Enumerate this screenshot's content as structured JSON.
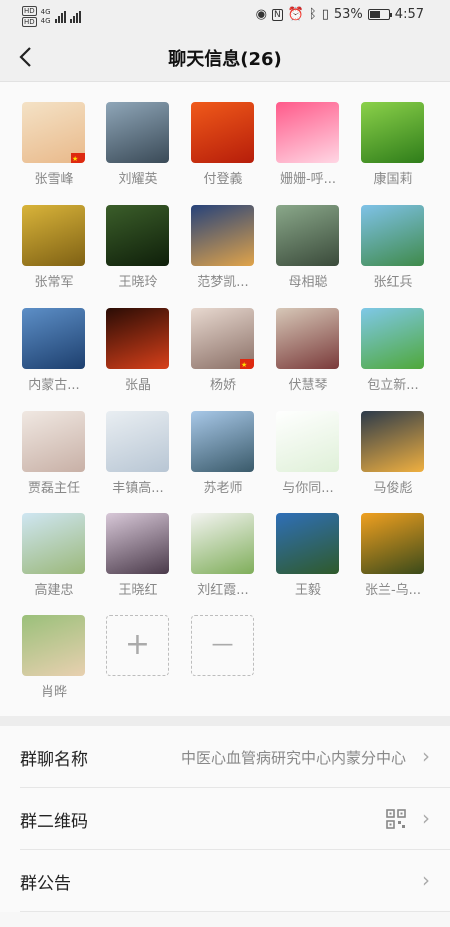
{
  "status_bar": {
    "network_left": [
      "HD",
      "4G",
      "HD",
      "4G"
    ],
    "battery": "53%",
    "time": "4:57"
  },
  "header": {
    "back_icon": "chevron-left-icon",
    "title": "聊天信息(26)"
  },
  "members": [
    {
      "name": "张雪峰",
      "avatar_colors": [
        "#f4e2c6",
        "#e9b98a"
      ],
      "flag": true
    },
    {
      "name": "刘耀英",
      "avatar_colors": [
        "#8fa6b8",
        "#3a4a57"
      ]
    },
    {
      "name": "付登義",
      "avatar_colors": [
        "#f05a1a",
        "#b61d0a"
      ]
    },
    {
      "name": "姗姗-呼...",
      "avatar_colors": [
        "#ff5a8a",
        "#ffd7e4"
      ]
    },
    {
      "name": "康国莉",
      "avatar_colors": [
        "#8bd14a",
        "#2f7d1a"
      ]
    },
    {
      "name": "张常军",
      "avatar_colors": [
        "#d9b43a",
        "#7f6114"
      ]
    },
    {
      "name": "王晓玲",
      "avatar_colors": [
        "#3b5e2a",
        "#0f1f0a"
      ]
    },
    {
      "name": "范梦凯...",
      "avatar_colors": [
        "#26427a",
        "#e1a44a"
      ]
    },
    {
      "name": "母相聪",
      "avatar_colors": [
        "#8aa88a",
        "#3a4a3a"
      ]
    },
    {
      "name": "张红兵",
      "avatar_colors": [
        "#7fc2e8",
        "#3f8a4a"
      ]
    },
    {
      "name": "内蒙古...",
      "avatar_colors": [
        "#5d8fc7",
        "#1d3f6e"
      ]
    },
    {
      "name": "张晶",
      "avatar_colors": [
        "#2a0c05",
        "#d8401a"
      ]
    },
    {
      "name": "杨娇",
      "avatar_colors": [
        "#e8d9d0",
        "#8a6f66"
      ],
      "flag": true
    },
    {
      "name": "伏慧琴",
      "avatar_colors": [
        "#d7c8b8",
        "#7a3a3a"
      ]
    },
    {
      "name": "包立新...",
      "avatar_colors": [
        "#7fc8e8",
        "#4fa83a"
      ]
    },
    {
      "name": "贾磊主任",
      "avatar_colors": [
        "#f0e8e2",
        "#c8b0a6"
      ]
    },
    {
      "name": "丰镇高...",
      "avatar_colors": [
        "#e9eef2",
        "#b8c6d4"
      ]
    },
    {
      "name": "苏老师",
      "avatar_colors": [
        "#a8c8e8",
        "#3a5a6a"
      ]
    },
    {
      "name": "与你同...",
      "avatar_colors": [
        "#ffffff",
        "#dff0d8"
      ]
    },
    {
      "name": "马俊彪",
      "avatar_colors": [
        "#2c3a4a",
        "#f0b040"
      ]
    },
    {
      "name": "高建忠",
      "avatar_colors": [
        "#cfe6f2",
        "#9bb87a"
      ]
    },
    {
      "name": "王晓红",
      "avatar_colors": [
        "#d8c8d8",
        "#4a3a4a"
      ]
    },
    {
      "name": "刘红霞...",
      "avatar_colors": [
        "#f4f4f2",
        "#7fae5a"
      ]
    },
    {
      "name": "王毅",
      "avatar_colors": [
        "#2f6fb8",
        "#2f5a2a"
      ]
    },
    {
      "name": "张兰-乌...",
      "avatar_colors": [
        "#f0a020",
        "#3a4a1a"
      ]
    },
    {
      "name": "肖晔",
      "avatar_colors": [
        "#9ac07a",
        "#e8d0b0"
      ]
    }
  ],
  "controls": {
    "add_symbol": "+",
    "remove_symbol": "—"
  },
  "settings": {
    "group_name_label": "群聊名称",
    "group_name_value": "中医心血管病研究中心内蒙分中心",
    "qr_label": "群二维码",
    "notice_label": "群公告",
    "chevron": "›"
  }
}
